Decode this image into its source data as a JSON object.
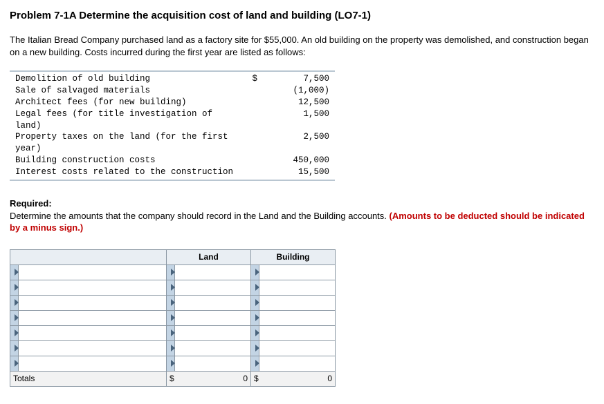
{
  "title": "Problem 7-1A Determine the acquisition cost of land and building (LO7-1)",
  "intro": "The Italian Bread Company purchased land as a factory site for $55,000. An old building on the property was demolished, and construction began on a new building. Costs incurred during the first year are listed as follows:",
  "costs": [
    {
      "label": "Demolition of old building",
      "sym": "$",
      "value": "7,500"
    },
    {
      "label": "Sale of salvaged materials",
      "sym": "",
      "value": "(1,000)"
    },
    {
      "label": "Architect fees (for new building)",
      "sym": "",
      "value": "12,500"
    },
    {
      "label": "Legal fees (for title investigation of land)",
      "sym": "",
      "value": "1,500"
    },
    {
      "label": "Property taxes on the land (for the first year)",
      "sym": "",
      "value": "2,500"
    },
    {
      "label": "Building construction costs",
      "sym": "",
      "value": "450,000"
    },
    {
      "label": "Interest costs related to the construction",
      "sym": "",
      "value": "15,500"
    }
  ],
  "required": {
    "label": "Required:",
    "text": "Determine the amounts that the company should record in the Land and the Building accounts. ",
    "note": "(Amounts to be deducted should be indicated by a minus sign.)"
  },
  "answer_table": {
    "headers": {
      "land": "Land",
      "building": "Building"
    },
    "blank_rows": 7,
    "totals": {
      "label": "Totals",
      "land_sym": "$",
      "land_val": "0",
      "bldg_sym": "$",
      "bldg_val": "0"
    }
  }
}
